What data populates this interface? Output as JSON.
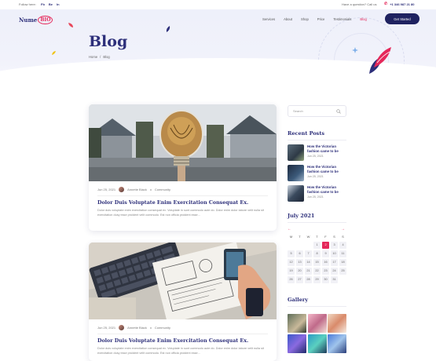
{
  "topbar": {
    "follow": "Follow here:",
    "socials": [
      "Fb",
      "Be",
      "In"
    ],
    "question": "Have a question? Call us",
    "phone": "+1 346 987 21 80"
  },
  "brand": {
    "name": "Nume",
    "accent": "BIO",
    "accent_color": "#e5285a",
    "primary_color": "#2d2f7a"
  },
  "nav": {
    "items": [
      {
        "label": "Services"
      },
      {
        "label": "About"
      },
      {
        "label": "Shop"
      },
      {
        "label": "Price"
      },
      {
        "label": "Testimonials"
      },
      {
        "label": "Blog",
        "active": true
      }
    ],
    "cta": "Get Started"
  },
  "hero": {
    "title": "Blog",
    "breadcrumb": [
      "Home",
      "/",
      "Blog"
    ]
  },
  "posts": [
    {
      "date": "Jun 25, 2021",
      "author": "Annette Black",
      "category": "Community",
      "title": "Dolor Duis Voluptate Enim Exercitation Consequat Ex.",
      "excerpt": "Dolor duis voluptate enim exercitation consequat ex. Voluptate in sunt commodo aute do. Dolor enim dolor labore velit nulla sit exercitation dusy esse proident velit commodo. Est non officia proident esse..."
    },
    {
      "date": "Jun 25, 2021",
      "author": "Annette Black",
      "category": "Community",
      "title": "Dolor Duis Voluptate Enim Exercitation Consequat Ex.",
      "excerpt": "Dolor duis voluptate enim exercitation consequat ex. Voluptate in sunt commodo aute do. Dolor enim dolor labore velit nulla sit exercitation dusy esse proident velit commodo. Est non officia proident esse..."
    }
  ],
  "sidebar": {
    "search_placeholder": "Search",
    "recent_heading": "Recent Posts",
    "recent": [
      {
        "title": "How the Victorian fashion came to be",
        "date": "Jun 25, 2021"
      },
      {
        "title": "How the Victorian fashion came to be",
        "date": "Jun 25, 2021"
      },
      {
        "title": "How the Victorian fashion came to be",
        "date": "Jun 25, 2021"
      }
    ],
    "calendar": {
      "heading": "July 2021",
      "prev": "←",
      "next": "→",
      "day_names": [
        "M",
        "T",
        "W",
        "T",
        "F",
        "S",
        "S"
      ],
      "days": [
        "",
        "",
        "",
        "1",
        "2",
        "3",
        "4",
        "5",
        "6",
        "7",
        "8",
        "9",
        "10",
        "11",
        "12",
        "13",
        "14",
        "15",
        "16",
        "17",
        "18",
        "19",
        "20",
        "21",
        "22",
        "23",
        "24",
        "25",
        "26",
        "27",
        "28",
        "29",
        "30",
        "31",
        ""
      ],
      "today": "2"
    },
    "gallery_heading": "Gallery"
  }
}
